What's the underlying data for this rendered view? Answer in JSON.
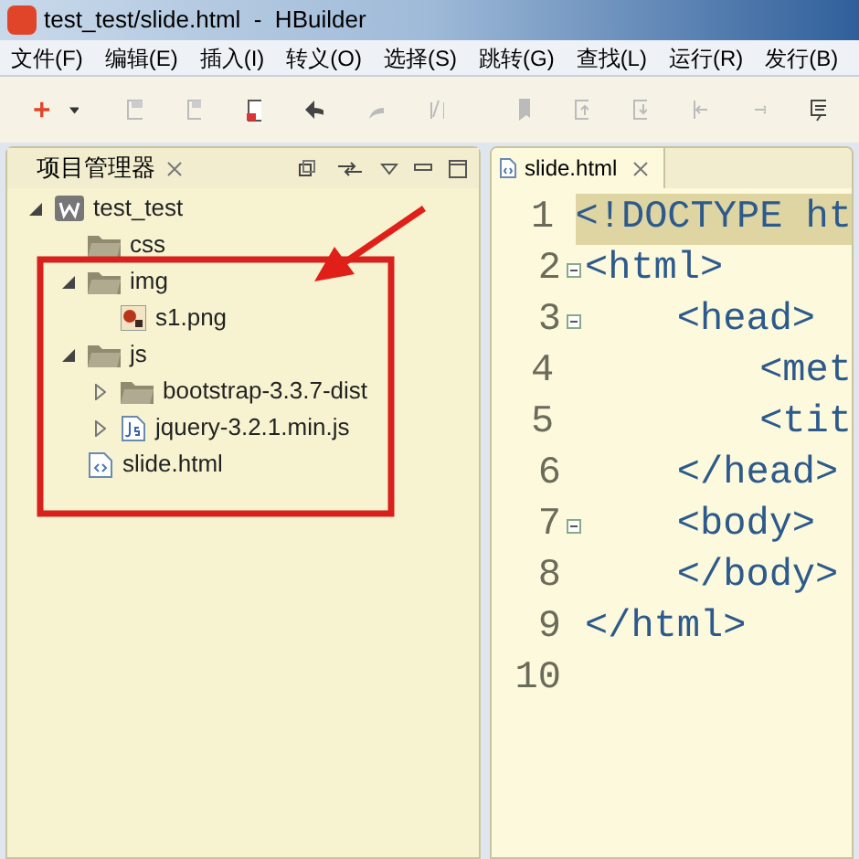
{
  "window": {
    "title": "test_test/slide.html  -  HBuilder"
  },
  "menu": [
    "文件(F)",
    "编辑(E)",
    "插入(I)",
    "转义(O)",
    "选择(S)",
    "跳转(G)",
    "查找(L)",
    "运行(R)",
    "发行(B)"
  ],
  "project_panel": {
    "tab": "项目管理器",
    "tree": [
      {
        "label": "test_test",
        "kind": "project",
        "expanded": true,
        "children": [
          {
            "label": "css",
            "kind": "folder"
          },
          {
            "label": "img",
            "kind": "folder",
            "expanded": true,
            "children": [
              {
                "label": "s1.png",
                "kind": "image"
              }
            ]
          },
          {
            "label": "js",
            "kind": "folder",
            "expanded": true,
            "children": [
              {
                "label": "bootstrap-3.3.7-dist",
                "kind": "folder",
                "expanded": false
              },
              {
                "label": "jquery-3.2.1.min.js",
                "kind": "script",
                "expanded": false
              }
            ]
          },
          {
            "label": "slide.html",
            "kind": "html"
          }
        ]
      }
    ]
  },
  "editor": {
    "tab": "slide.html",
    "lines": [
      {
        "number": "1",
        "text": "<!DOCTYPE ht",
        "selected": true
      },
      {
        "number": "2",
        "text": "<html>",
        "selected": false,
        "fold": true
      },
      {
        "number": "3",
        "text": "    <head>",
        "selected": false,
        "fold": true
      },
      {
        "number": "4",
        "text": "        <met",
        "selected": false
      },
      {
        "number": "5",
        "text": "        <tit",
        "selected": false
      },
      {
        "number": "6",
        "text": "    </head>",
        "selected": false
      },
      {
        "number": "7",
        "text": "    <body>",
        "selected": false,
        "fold": true
      },
      {
        "number": "8",
        "text": "    </body>",
        "selected": false
      },
      {
        "number": "9",
        "text": "</html>",
        "selected": false
      },
      {
        "number": "10",
        "selected": false
      }
    ]
  }
}
